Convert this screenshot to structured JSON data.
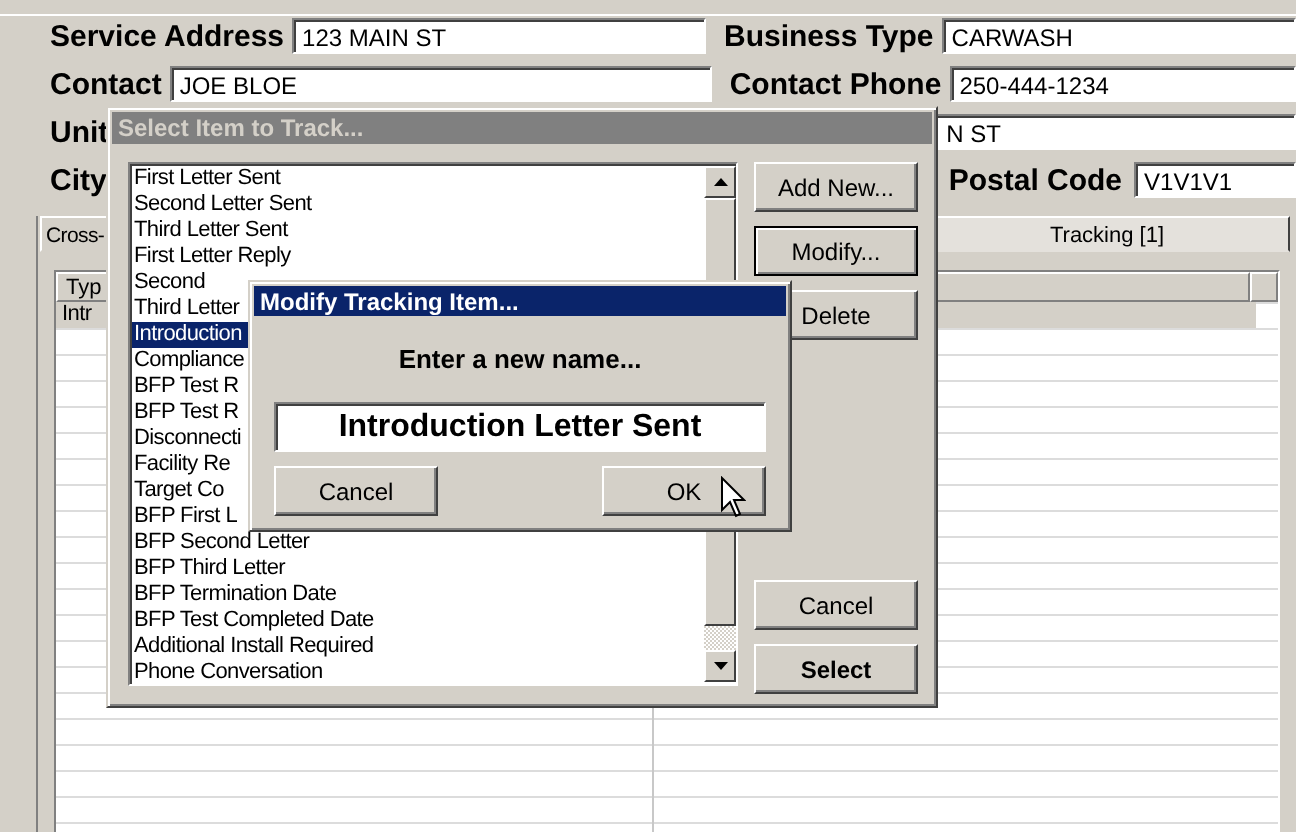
{
  "form": {
    "rows": [
      {
        "left": {
          "label": "Service Address",
          "value": "123 MAIN ST"
        },
        "right": {
          "label": "Business Type",
          "value": "CARWASH"
        }
      },
      {
        "left": {
          "label": "Contact",
          "value": "JOE BLOE"
        },
        "right": {
          "label": "Contact Phone",
          "value": "250-444-1234"
        }
      },
      {
        "left": {
          "label": "Unit"
        },
        "right": {
          "value": "N ST"
        }
      },
      {
        "left": {
          "label": "City"
        },
        "right": {
          "label": "Postal Code",
          "value": "V1V1V1"
        }
      }
    ]
  },
  "tabs": [
    {
      "label": "Cross-",
      "selected": false
    },
    {
      "label": "Tracking  [1]",
      "selected": true
    }
  ],
  "table": {
    "columns": [
      "Typ"
    ],
    "rows": [
      {
        "cells": [
          "Intr"
        ],
        "selected": true
      }
    ]
  },
  "select_dialog": {
    "title": "Select Item to Track...",
    "items": [
      {
        "label": "First Letter Sent",
        "selected": false
      },
      {
        "label": "Second Letter Sent",
        "selected": false
      },
      {
        "label": "Third Letter Sent",
        "selected": false
      },
      {
        "label": "First Letter Reply",
        "selected": false
      },
      {
        "label": "Second",
        "selected": false
      },
      {
        "label": "Third Letter",
        "selected": false
      },
      {
        "label": "Introduction",
        "selected": true
      },
      {
        "label": "Compliance",
        "selected": false
      },
      {
        "label": "BFP Test R",
        "selected": false
      },
      {
        "label": "BFP Test R",
        "selected": false
      },
      {
        "label": "Disconnecti",
        "selected": false
      },
      {
        "label": "Facility Re",
        "selected": false
      },
      {
        "label": "Target Co",
        "selected": false
      },
      {
        "label": "BFP First L",
        "selected": false
      },
      {
        "label": "BFP Second Letter",
        "selected": false
      },
      {
        "label": "BFP Third Letter",
        "selected": false
      },
      {
        "label": "BFP Termination Date",
        "selected": false
      },
      {
        "label": "BFP Test Completed Date",
        "selected": false
      },
      {
        "label": "Additional Install Required",
        "selected": false
      },
      {
        "label": "Phone Conversation",
        "selected": false
      }
    ],
    "top_buttons": [
      {
        "label": "Add New...",
        "default": false,
        "bold": false
      },
      {
        "label": "Modify...",
        "default": true,
        "bold": false
      },
      {
        "label": "Delete",
        "default": false,
        "bold": false
      }
    ],
    "bottom_buttons": [
      {
        "label": "Cancel",
        "default": false,
        "bold": false
      },
      {
        "label": "Select",
        "default": false,
        "bold": true
      }
    ]
  },
  "modify_dialog": {
    "title": "Modify Tracking Item...",
    "prompt": "Enter a new name...",
    "value": "Introduction Letter Sent",
    "buttons": [
      {
        "label": "Cancel"
      },
      {
        "label": "OK"
      }
    ]
  }
}
